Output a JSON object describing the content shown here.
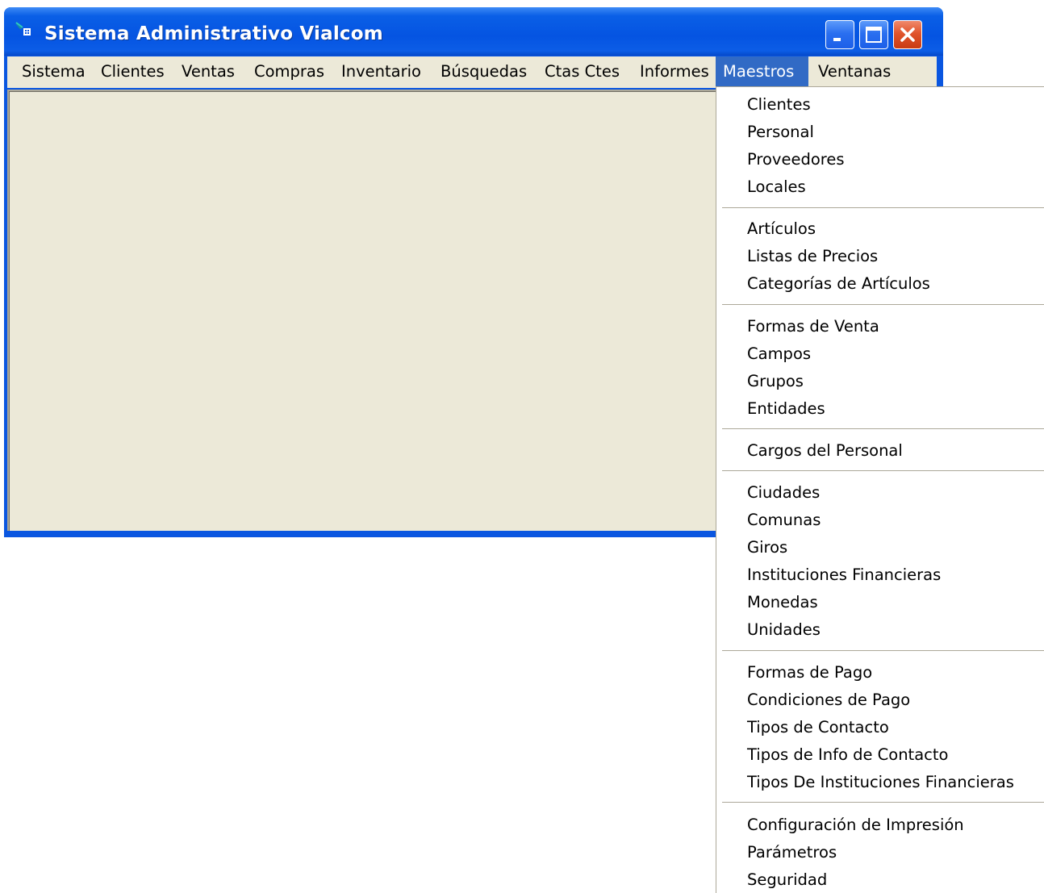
{
  "window": {
    "title": "Sistema Administrativo Vialcom",
    "icon": "app-icon",
    "controls": [
      "minimize-icon",
      "maximize-icon",
      "close-icon"
    ]
  },
  "menubar": {
    "items": [
      {
        "label": "Sistema"
      },
      {
        "label": "Clientes"
      },
      {
        "label": "Ventas"
      },
      {
        "label": "Compras"
      },
      {
        "label": "Inventario"
      },
      {
        "label": "Búsquedas"
      },
      {
        "label": "Ctas Ctes"
      },
      {
        "label": "Informes"
      },
      {
        "label": "Maestros",
        "active": true
      },
      {
        "label": "Ventanas"
      }
    ]
  },
  "dropdown": {
    "menu": "Maestros",
    "items": [
      {
        "label": "Clientes"
      },
      {
        "label": "Personal"
      },
      {
        "label": "Proveedores"
      },
      {
        "label": "Locales"
      },
      {
        "label": "Artículos"
      },
      {
        "label": "Listas de Precios"
      },
      {
        "label": "Categorías de Artículos"
      },
      {
        "label": "Formas de Venta"
      },
      {
        "label": "Campos"
      },
      {
        "label": "Grupos"
      },
      {
        "label": "Entidades"
      },
      {
        "label": "Cargos del Personal"
      },
      {
        "label": "Ciudades"
      },
      {
        "label": "Comunas"
      },
      {
        "label": "Giros"
      },
      {
        "label": "Instituciones Financieras"
      },
      {
        "label": "Monedas"
      },
      {
        "label": "Unidades"
      },
      {
        "label": "Formas de Pago"
      },
      {
        "label": "Condiciones de Pago"
      },
      {
        "label": "Tipos de Contacto"
      },
      {
        "label": "Tipos de Info de Contacto"
      },
      {
        "label": "Tipos De Instituciones Financieras"
      },
      {
        "label": "Configuración de Impresión"
      },
      {
        "label": "Parámetros"
      },
      {
        "label": "Seguridad"
      }
    ]
  },
  "colors": {
    "titlebar": "#0554e2",
    "menu_highlight": "#316ac5",
    "menu_background": "#ece9d8",
    "close_button": "#e0542c"
  }
}
